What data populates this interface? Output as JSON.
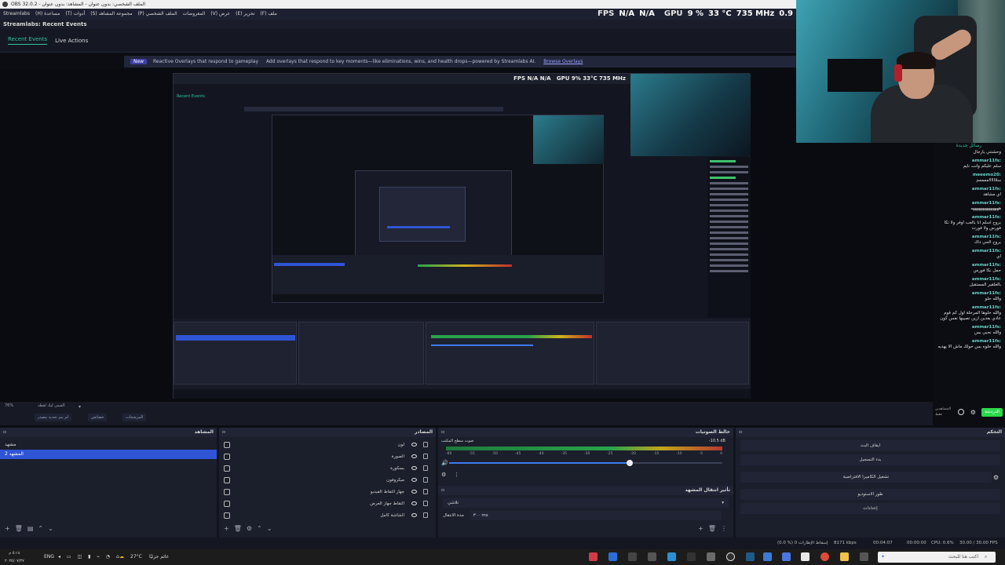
{
  "window": {
    "title": "OBS 32.0.2 - الملف الشخصي: بدون عنوان - المشاهد: بدون عنوان"
  },
  "menu": {
    "items": [
      "ملف (F)",
      "تحرير (E)",
      "عرض (V)",
      "المعروضات",
      "الملف الشخصي (P)",
      "مجموعة المشاهد (S)",
      "أدوات (T)",
      "مساعدة (H)",
      "Streamlabs"
    ]
  },
  "stats": {
    "fps_label": "FPS",
    "fps_value": "N/A",
    "fps_value2": "N/A",
    "gpu_label": "GPU",
    "gpu_usage": "9 %",
    "gpu_temp": "33 °C",
    "gpu_clock": "735 MHz",
    "gpu_extra": "0.9"
  },
  "streamlabs": {
    "dock_title": "Streamlabs: Recent Events",
    "tab_recent": "Recent Events",
    "tab_live": "Live Actions",
    "banner_new": "New",
    "banner_title": "Reactive Overlays that respond to gameplay",
    "banner_text": "Add overlays that respond to key moments—like eliminations, wins, and health drops—powered by Streamlabs AI.",
    "banner_link": "Browse Overlays"
  },
  "chat": {
    "title": "رسائل جديدة",
    "messages": [
      {
        "user": "",
        "text": "وحشتني يارجال"
      },
      {
        "user": "ammar11fs:",
        "text": "سلم عليكم وانت نايم"
      },
      {
        "user": "meeemo20:",
        "text": "سلااااااممممم"
      },
      {
        "user": "ammar11fs:",
        "text": "اي مشاهد"
      },
      {
        "user": "ammar11fs:",
        "text": "ههههههههههههههه"
      },
      {
        "user": "ammar11fs:",
        "text": "بروح اسلم انا بالعب اوفر ولا نكا فورس ولا فورت"
      },
      {
        "user": "ammar11fs:",
        "text": "بروح الحي داك"
      },
      {
        "user": "ammar11fs:",
        "text": "اي"
      },
      {
        "user": "ammar11fs:",
        "text": "حمل نكا فورس"
      },
      {
        "user": "ammar11fs:",
        "text": "بالغلقير المستقبل"
      },
      {
        "user": "ammar11fs:",
        "text": "والله حلو"
      },
      {
        "user": "ammar11fs:",
        "text": "والله حلوها المرحلة اول كم قوم عادي بعدين ازين تصيبها نفس كون"
      },
      {
        "user": "ammar11fs:",
        "text": "والله نحبي بس"
      },
      {
        "user": "ammar11fs:",
        "text": "والله حلوه بس حولك ماش الا يهديه"
      }
    ],
    "footer_note": "المشاهدين فقط",
    "send_label": "الدردشة"
  },
  "controls_strip": {
    "zoom": "76%",
    "mode_label": "الفيس ليك لقطه",
    "btn_studio": "لم يتم تحديد مصدر",
    "btn_props": "خصائص",
    "btn_filters": "المرشحات"
  },
  "scenes": {
    "title": "المشاهد",
    "items": [
      "مشهد",
      "المشهد 2"
    ],
    "selected": 1
  },
  "sources": {
    "title": "المصادر",
    "items": [
      {
        "label": "لون",
        "icon": "color-icon"
      },
      {
        "label": "الصورة",
        "icon": "image-icon"
      },
      {
        "label": "بسكورة",
        "icon": "browser-icon"
      },
      {
        "label": "ميكروفون",
        "icon": "media-icon"
      },
      {
        "label": "جهاز التقاط الفيديو",
        "icon": "camera-icon"
      },
      {
        "label": "التقاط جهاز العرض",
        "icon": "display-icon"
      },
      {
        "label": "الشاشة كامل",
        "icon": "link-icon"
      }
    ]
  },
  "mixer": {
    "title": "خالط الصوتيات",
    "track_name": "صوت سطح المكتب",
    "track_db": "-10.5 dB",
    "ticks": [
      "-60",
      "-55",
      "-50",
      "-45",
      "-40",
      "-35",
      "-30",
      "-25",
      "-20",
      "-15",
      "-10",
      "-5",
      "0"
    ],
    "volume_fraction": 0.66
  },
  "transitions": {
    "title": "تأثير انتقال المشهد",
    "selected": "تلاشي",
    "duration_label": "مدة الانتقال",
    "duration_value": "٣٠٠ ms"
  },
  "controls": {
    "title": "التحكم",
    "buttons": [
      "ايقاف البث",
      "بدء التسجيل",
      "تشغيل الكاميرا الافتراضية",
      "طور الاستوديو",
      "إعدادات"
    ]
  },
  "statusbar": {
    "dropped": "(0.0 %) 0 إسقاط الإطارات",
    "bitrate": "8171 kbps",
    "time_live": "00:04:07",
    "time_rec": "00:00:00",
    "cpu": "CPU: 0.6%",
    "fps": "30.00 / 30.00 FPS"
  },
  "taskbar": {
    "time": "٥:١٤ م",
    "date": "٢٠٢٥/٠٧/٢٧",
    "lang": "ENG",
    "weather": "27°C",
    "weather_text": "غائم جزئيًا",
    "search_placeholder": "اكتب هنا للبحث"
  }
}
